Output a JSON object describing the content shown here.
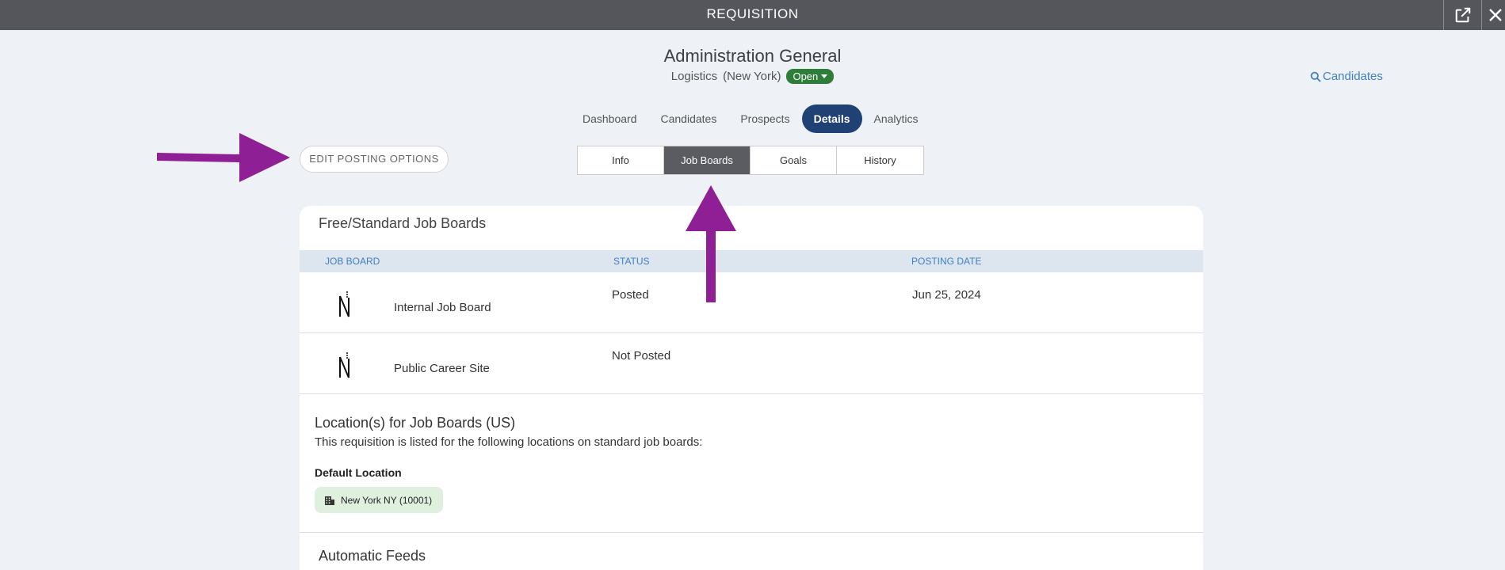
{
  "window": {
    "title": "REQUISITION"
  },
  "header": {
    "title": "Administration General",
    "department": "Logistics",
    "location": "(New York)",
    "status": "Open"
  },
  "candidates_link": "Candidates",
  "tabs": [
    "Dashboard",
    "Candidates",
    "Prospects",
    "Details",
    "Analytics"
  ],
  "active_tab": "Details",
  "edit_button": "EDIT POSTING OPTIONS",
  "sub_tabs": [
    "Info",
    "Job Boards",
    "Goals",
    "History"
  ],
  "active_sub_tab": "Job Boards",
  "free_boards": {
    "title": "Free/Standard Job Boards",
    "columns": [
      "JOB BOARD",
      "STATUS",
      "POSTING DATE"
    ],
    "rows": [
      {
        "name": "Internal Job Board",
        "status": "Posted",
        "date": "Jun 25, 2024"
      },
      {
        "name": "Public Career Site",
        "status": "Not Posted",
        "date": ""
      }
    ]
  },
  "locations": {
    "title": "Location(s) for Job Boards (US)",
    "description": "This requisition is listed for the following locations on standard job boards:",
    "default_label": "Default Location",
    "default_location": "New York NY (10001)"
  },
  "feeds": {
    "title": "Automatic Feeds"
  },
  "colors": {
    "accent": "#1f4173",
    "open_status": "#2e7d3b",
    "annotation_arrow": "#8e1f95"
  }
}
